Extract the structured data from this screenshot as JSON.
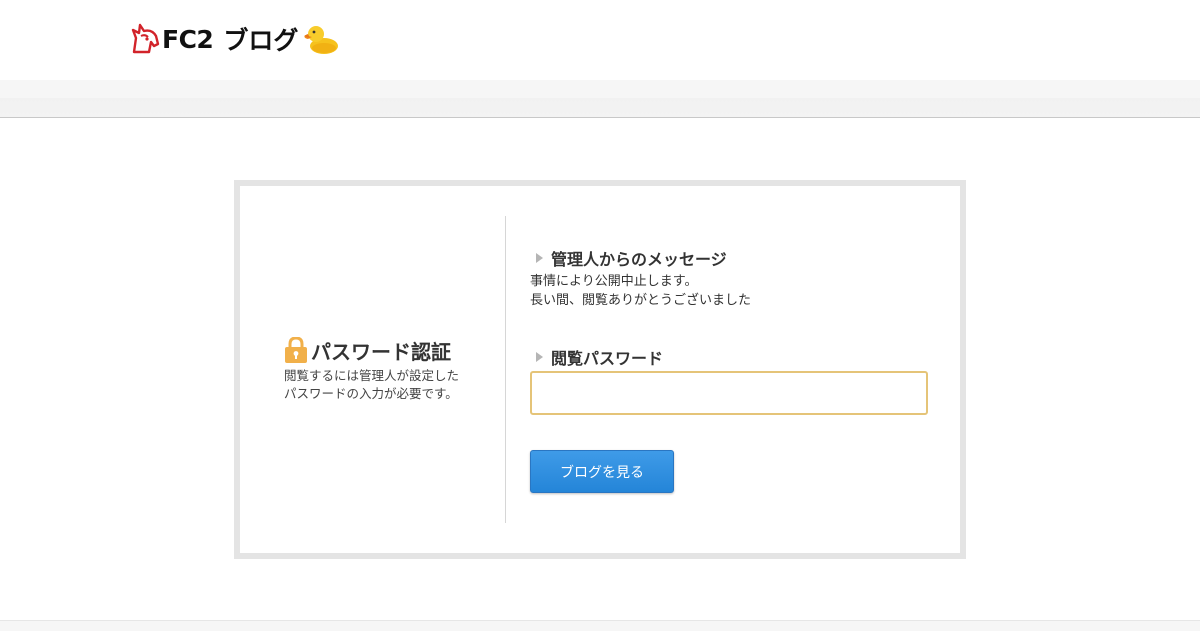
{
  "header": {
    "logo_brand": "FC2",
    "logo_service": "ブログ",
    "logo_icon": "fc2-unicorn-mark",
    "mascot_icon": "duck-icon"
  },
  "auth": {
    "lock_icon": "lock-icon",
    "title": "パスワード認証",
    "desc_line1": "閲覧するには管理人が設定した",
    "desc_line2": "パスワードの入力が必要です。"
  },
  "message": {
    "heading": "管理人からのメッセージ",
    "line1": "事情により公開中止します。",
    "line2": "長い間、閲覧ありがとうございました"
  },
  "password": {
    "heading": "閲覧パスワード",
    "value": "",
    "placeholder": ""
  },
  "button": {
    "label": "ブログを見る"
  },
  "colors": {
    "accent_blue": "#2485d8",
    "input_border": "#e5c478",
    "lock_orange": "#f1b04a",
    "brand_red": "#d2232a"
  }
}
